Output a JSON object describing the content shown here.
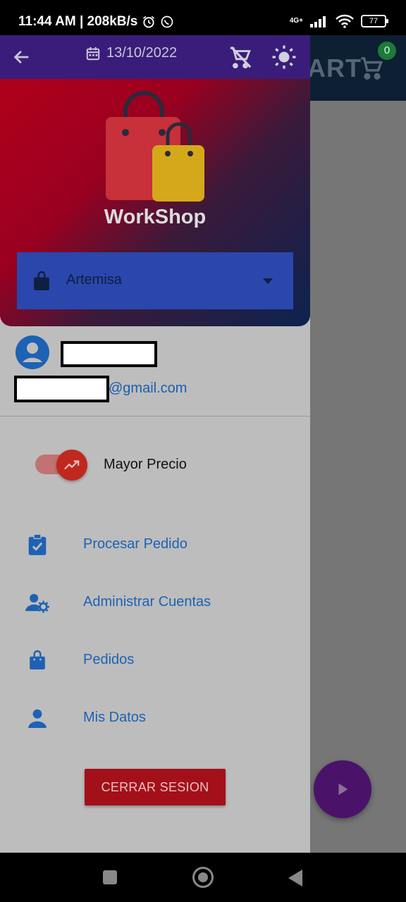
{
  "status_bar": {
    "time_speed": "11:44 AM | 208kB/s",
    "network": "4G+",
    "battery": "77"
  },
  "background_app": {
    "title": "ART",
    "cart_count": "0"
  },
  "drawer": {
    "date": "13/10/2022",
    "brand": "WorkShop",
    "store_select": {
      "selected": "Artemisa"
    },
    "user": {
      "email_suffix": "@gmail.com"
    },
    "sort_toggle": {
      "label": "Mayor Precio",
      "on": true
    },
    "menu": [
      {
        "label": "Procesar Pedido",
        "icon": "clipboard-check-icon"
      },
      {
        "label": "Administrar Cuentas",
        "icon": "manage-accounts-icon"
      },
      {
        "label": "Pedidos",
        "icon": "shopping-bag-icon"
      },
      {
        "label": "Mis Datos",
        "icon": "person-icon"
      }
    ],
    "logout_label": "CERRAR SESION"
  },
  "colors": {
    "toolbar": "#3a1d7a",
    "accent_link": "#1d62b4",
    "logout": "#a3101a",
    "select": "#2a47ad"
  }
}
